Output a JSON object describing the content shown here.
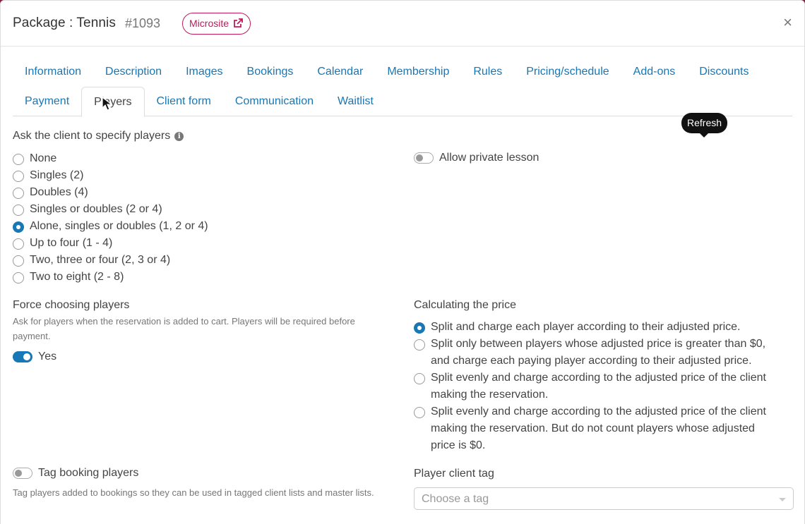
{
  "header": {
    "title": "Package : Tennis",
    "package_id": "#1093",
    "microsite_label": "Microsite",
    "close_symbol": "×"
  },
  "tabs": {
    "row1": [
      "Information",
      "Description",
      "Images",
      "Bookings",
      "Calendar",
      "Membership",
      "Rules",
      "Pricing/schedule",
      "Add-ons",
      "Discounts"
    ],
    "row2": [
      "Payment",
      "Players",
      "Client form",
      "Communication",
      "Waitlist"
    ],
    "active": "Players"
  },
  "tooltip": "Refresh",
  "players": {
    "label": "Ask the client to specify players",
    "options": [
      "None",
      "Singles (2)",
      "Doubles (4)",
      "Singles or doubles (2 or 4)",
      "Alone, singles or doubles (1, 2 or 4)",
      "Up to four (1 - 4)",
      "Two, three or four (2, 3 or 4)",
      "Two to eight (2 - 8)"
    ],
    "selected": "Alone, singles or doubles (1, 2 or 4)"
  },
  "private_lesson": {
    "label": "Allow private lesson",
    "on": false
  },
  "force_choosing": {
    "label": "Force choosing players",
    "help": "Ask for players when the reservation is added to cart. Players will be required before payment.",
    "toggle_label": "Yes",
    "on": true
  },
  "pricing": {
    "label": "Calculating the price",
    "options": [
      "Split and charge each player according to their adjusted price.",
      "Split only between players whose adjusted price is greater than $0, and charge each paying player according to their adjusted price.",
      "Split evenly and charge according to the adjusted price of the client making the reservation.",
      "Split evenly and charge according to the adjusted price of the client making the reservation. But do not count players whose adjusted price is $0."
    ],
    "selected_index": 0
  },
  "tag_booking": {
    "label": "Tag booking players",
    "help": "Tag players added to bookings so they can be used in tagged client lists and master lists.",
    "on": false
  },
  "player_client_tag": {
    "label": "Player client tag",
    "placeholder": "Choose a tag"
  },
  "colors": {
    "accent": "#1877b5",
    "brand": "#c2185b"
  }
}
